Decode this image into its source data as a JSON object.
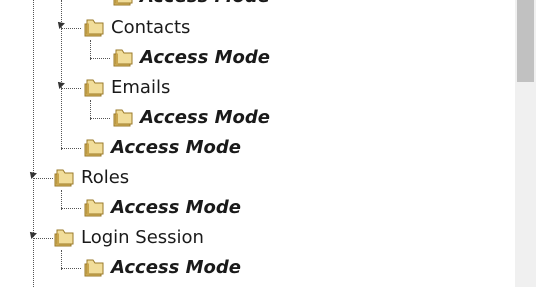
{
  "tree": {
    "top_item": "Access Mode",
    "contacts": {
      "label": "Contacts",
      "child": "Access Mode"
    },
    "emails": {
      "label": "Emails",
      "child": "Access Mode"
    },
    "sibling_access": "Access Mode",
    "roles": {
      "label": "Roles",
      "child": "Access Mode"
    },
    "login_session": {
      "label": "Login Session",
      "child": "Access Mode"
    }
  },
  "colors": {
    "folder": "#e2c773",
    "folder_dark": "#b08d3c",
    "line": "#555555"
  }
}
